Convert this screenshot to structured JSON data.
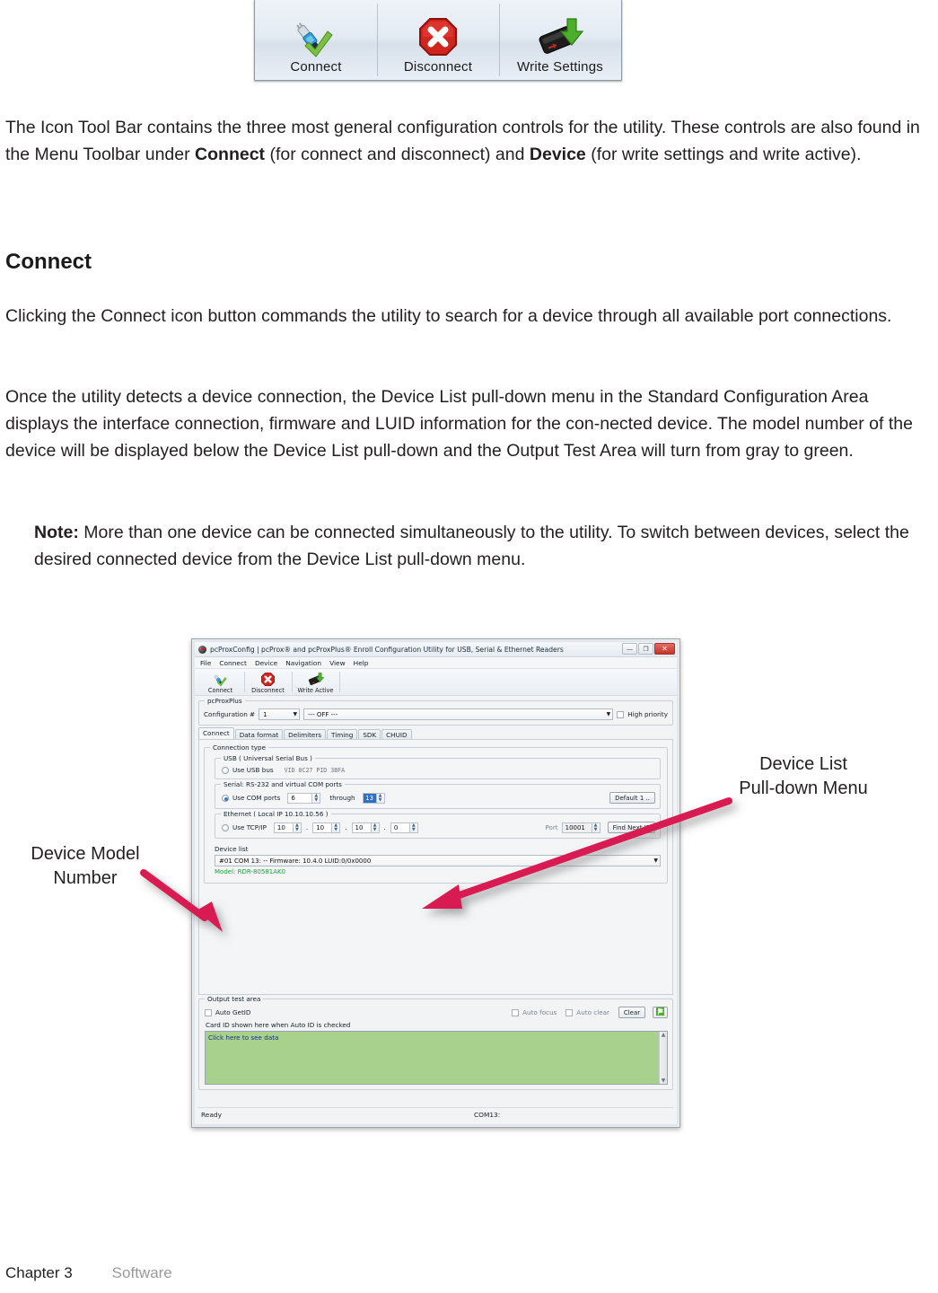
{
  "figure_toolbar": {
    "buttons": [
      {
        "label": "Connect",
        "icon": "usb-plug-check-icon"
      },
      {
        "label": "Disconnect",
        "icon": "red-octagon-x-icon"
      },
      {
        "label": "Write Settings",
        "icon": "reader-download-arrow-icon"
      }
    ]
  },
  "body": {
    "p1_a": "The Icon Tool Bar contains the three most general configuration controls for the utility. These controls are also found in the Menu Toolbar under ",
    "p1_b": "Connect",
    "p1_c": " (for connect and disconnect) and ",
    "p1_d": "Device",
    "p1_e": " (for write settings and write active).",
    "heading": "Connect",
    "p2": "Clicking the Connect icon button commands the utility to search for a device through all available port connections.",
    "p3": "Once the utility detects a device connection, the Device List pull-down menu in the Standard Configuration Area displays the interface connection, firmware and LUID information for the con-nected device. The model number of the device will be displayed below the Device List pull-down and the Output Test Area will turn from gray to green.",
    "note_label": "Note:",
    "note_text": " More than one device can be connected simultaneously to the utility. To switch between devices, select the desired connected device from the Device List pull-down menu."
  },
  "annotations": {
    "device_list": "Device List\nPull-down Menu",
    "device_list_l1": "Device List",
    "device_list_l2": "Pull-down Menu",
    "device_model_l1": "Device Model",
    "device_model_l2": "Number",
    "arrow_color": "#D81B52"
  },
  "app": {
    "title": "pcProxConfig | pcProx® and pcProxPlus® Enroll Configuration Utility for USB, Serial & Ethernet Readers",
    "window_buttons": {
      "minimize": "—",
      "maximize": "❐",
      "close": "✕"
    },
    "menu": [
      "File",
      "Connect",
      "Device",
      "Navigation",
      "View",
      "Help"
    ],
    "toolbar": [
      {
        "label": "Connect",
        "icon": "usb-plug-check-icon"
      },
      {
        "label": "Disconnect",
        "icon": "red-octagon-x-icon"
      },
      {
        "label": "Write Active",
        "icon": "reader-download-arrow-icon"
      }
    ],
    "config_group": {
      "title": "pcProxPlus",
      "config_label": "Configuration #",
      "config_value": "1",
      "profile_value": "--- OFF ---",
      "high_priority_label": "High priority"
    },
    "tabs": [
      {
        "label": "Connect",
        "active": true
      },
      {
        "label": "Data format",
        "active": false
      },
      {
        "label": "Delimiters",
        "active": false
      },
      {
        "label": "Timing",
        "active": false
      },
      {
        "label": "SDK",
        "active": false
      },
      {
        "label": "CHUID",
        "active": false
      }
    ],
    "connection_type": {
      "title": "Connection type",
      "usb": {
        "title": "USB ( Universal Serial Bus )",
        "radio_label": "Use USB bus",
        "selected": false,
        "detail": "VID 0C27 PID 3BFA"
      },
      "serial": {
        "title": "Serial: RS-232 and virtual COM ports",
        "radio_label": "Use COM ports",
        "selected": true,
        "from": "6",
        "through_label": "through",
        "to": "13",
        "default_button": "Default 1 .."
      },
      "ethernet": {
        "title": "Ethernet ( Local IP 10.10.10.56 )",
        "radio_label": "Use TCP/IP",
        "selected": false,
        "octets": [
          "10",
          "10",
          "10",
          "0"
        ],
        "port_label": "Port",
        "port_value": "10001",
        "find_button": "Find Next IP"
      }
    },
    "device_list": {
      "label": "Device list",
      "selected": "#01 COM 13: -- Firmware: 10.4.0 LUID:0/0x0000",
      "model_text": "Model: RDR-80581AK0",
      "model_color": "#1f9c3a"
    },
    "output_area": {
      "title": "Output test area",
      "auto_getid": "Auto GetID",
      "auto_focus": "Auto focus",
      "auto_clear": "Auto clear",
      "clear_button": "Clear",
      "flag_icon": "green-flag-icon",
      "hint": "Card ID shown here when Auto ID is checked",
      "box_text": "Click here to see data",
      "box_color": "#A9D18E"
    },
    "status": {
      "left": "Ready",
      "right": "COM13:"
    }
  },
  "footer": {
    "chapter": "Chapter 3",
    "section": "Software"
  }
}
